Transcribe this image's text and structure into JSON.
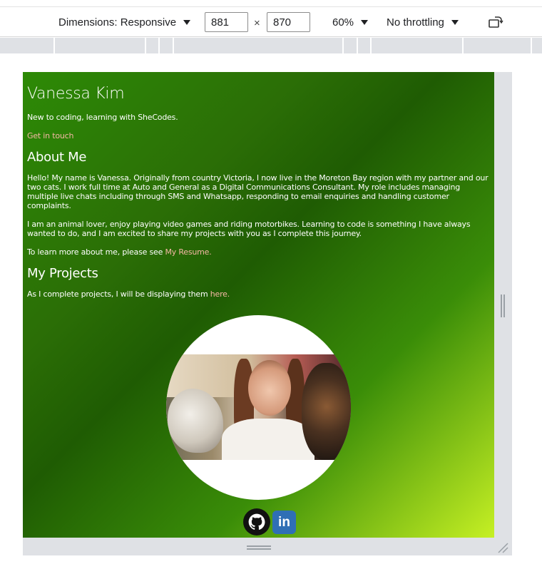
{
  "toolbar": {
    "dimensions_label": "Dimensions: Responsive",
    "width": "881",
    "times": "×",
    "height": "870",
    "zoom": "60%",
    "throttling": "No throttling"
  },
  "page": {
    "title": "Vanessa Kim",
    "intro": "New to coding, learning with SheCodes.",
    "contact_link": "Get in touch",
    "about_heading": "About Me",
    "about_p1": "Hello! My name is Vanessa. Originally from country Victoria, I now live in the Moreton Bay region with my partner and our two cats. I work full time at Auto and General as a Digital Communications Consultant. My role includes managing multiple live chats including through SMS and Whatsapp, responding to email enquiries and handling customer complaints.",
    "about_p2": "I am an animal lover, enjoy playing video games and riding motorbikes. Learning to code is something I have always wanted to do, and I am excited to share my projects with you as I complete this journey.",
    "resume_text": "To learn more about me, please see ",
    "resume_link": "My Resume.",
    "projects_heading": "My Projects",
    "projects_text": "As I complete projects, I will be displaying them ",
    "projects_link": "here.",
    "linkedin_glyph": "in"
  },
  "icons": {
    "github": "github-icon",
    "linkedin": "linkedin-icon",
    "rotate": "rotate-icon"
  },
  "colors": {
    "link": "#f5b7a4",
    "gradient_start": "#2d8a06",
    "gradient_end": "#c6f024",
    "linkedin_blue": "#2f6fb5"
  }
}
